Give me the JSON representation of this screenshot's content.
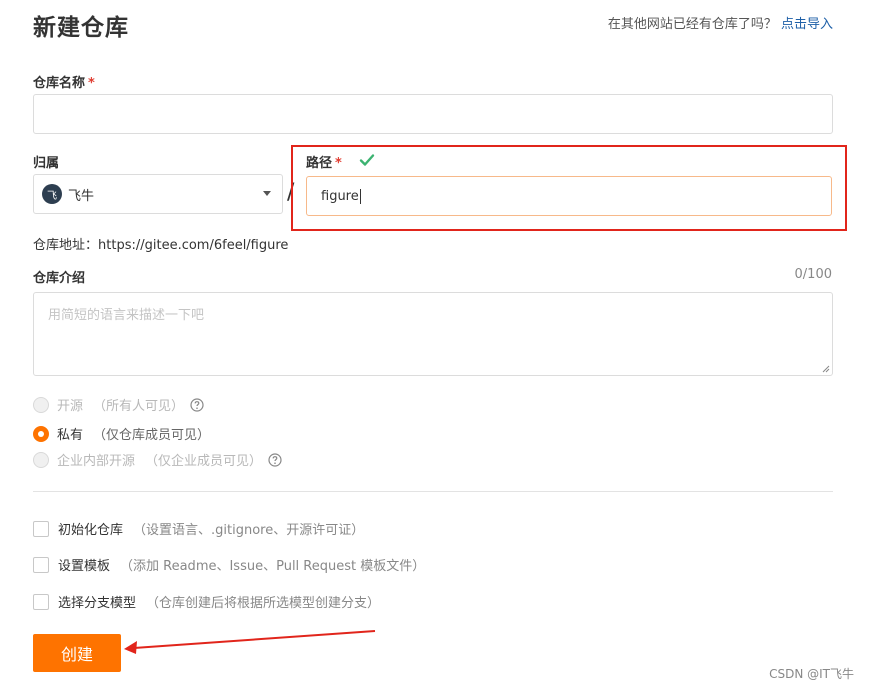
{
  "header": {
    "title": "新建仓库",
    "import_prompt": "在其他网站已经有仓库了吗？",
    "import_link": "点击导入"
  },
  "form": {
    "repo_name_label": "仓库名称",
    "required_mark": "*",
    "repo_name_value": "",
    "owner_label": "归属",
    "owner_avatar_text": "飞",
    "owner_value": "飞牛",
    "separator": "/",
    "path_label": "路径",
    "path_value": "figure",
    "address_label": "仓库地址：",
    "address_value": "https://gitee.com/6feel/figure",
    "intro_label": "仓库介绍",
    "intro_counter": "0/100",
    "intro_placeholder": "用简短的语言来描述一下吧"
  },
  "visibility": {
    "options": [
      {
        "label": "开源",
        "note": "（所有人可见）",
        "checked": false,
        "disabled": true
      },
      {
        "label": "私有",
        "note": "（仅仓库成员可见）",
        "checked": true,
        "disabled": false
      },
      {
        "label": "企业内部开源",
        "note": "（仅企业成员可见）",
        "checked": false,
        "disabled": true
      }
    ]
  },
  "options": [
    {
      "label": "初始化仓库",
      "note": "（设置语言、.gitignore、开源许可证）"
    },
    {
      "label": "设置模板",
      "note": "（添加 Readme、Issue、Pull Request 模板文件）"
    },
    {
      "label": "选择分支模型",
      "note": "（仓库创建后将根据所选模型创建分支）"
    }
  ],
  "submit_label": "创建",
  "watermark": "CSDN @IT飞牛",
  "colors": {
    "accent": "#fe7300",
    "highlight_border": "#e1251b",
    "link": "#1d5fa7",
    "valid_check": "#3cb371"
  }
}
